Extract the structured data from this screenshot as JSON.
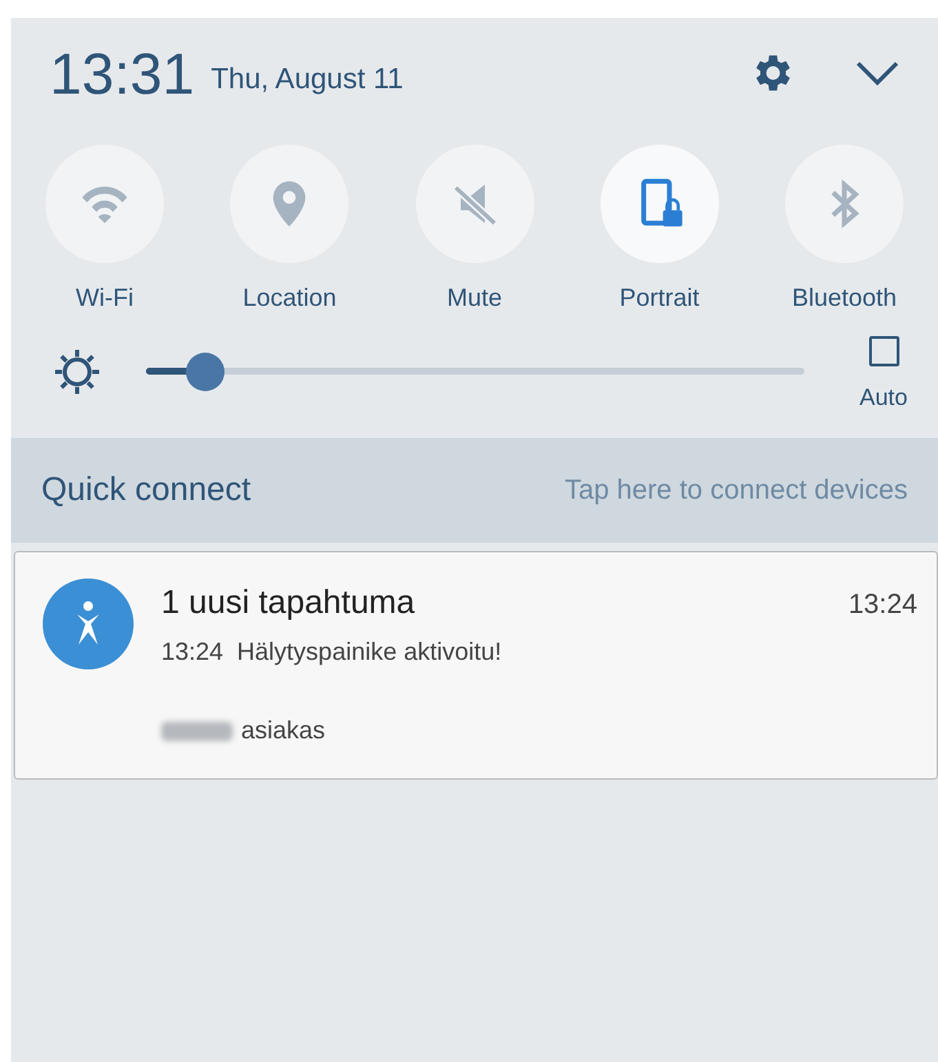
{
  "header": {
    "time": "13:31",
    "date": "Thu, August 11"
  },
  "toggles": [
    {
      "kind": "wifi",
      "label": "Wi-Fi",
      "on": false
    },
    {
      "kind": "location",
      "label": "Location",
      "on": false
    },
    {
      "kind": "mute",
      "label": "Mute",
      "on": false
    },
    {
      "kind": "portrait",
      "label": "Portrait",
      "on": true
    },
    {
      "kind": "bluetooth",
      "label": "Bluetooth",
      "on": false
    }
  ],
  "brightness": {
    "level": 0.09,
    "auto": {
      "label": "Auto",
      "checked": false
    }
  },
  "quick_connect": {
    "title": "Quick connect",
    "hint": "Tap here to connect devices"
  },
  "notification": {
    "title": "1 uusi tapahtuma",
    "time": "13:24",
    "line_time": "13:24",
    "message": "Hälytyspainike aktivoitu!",
    "footer": "asiakas"
  }
}
